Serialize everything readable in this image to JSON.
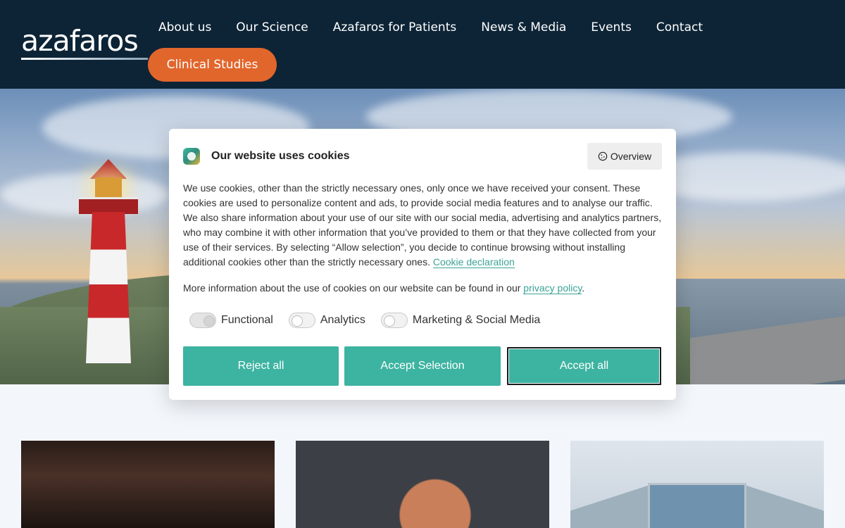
{
  "header": {
    "logo_text": "azafaros",
    "nav": [
      "About us",
      "Our Science",
      "Azafaros for Patients",
      "News & Media",
      "Events",
      "Contact"
    ],
    "cta_label": "Clinical Studies",
    "cta_color": "#e1662c",
    "background": "#0d2436"
  },
  "cookie_dialog": {
    "title": "Our website uses cookies",
    "overview_label": "Overview",
    "overview_icon": "cookie-icon",
    "body_text": "We use cookies, other than the strictly necessary ones, only once we have received your consent. These cookies are used to personalize content and ads, to provide social media features and to analyse our traffic. We also share information about your use of our site with our social media, advertising and analytics partners, who may combine it with other information that you’ve provided to them or that they have collected from your use of their services. By selecting “Allow selection”, you decide to continue browsing without installing additional cookies other than the strictly necessary ones.",
    "cookie_declaration_link": "Cookie declaration",
    "more_info_text": "More information about the use of cookies on our website can be found in our",
    "privacy_link": "privacy policy",
    "more_info_end": ".",
    "toggles": [
      {
        "label": "Functional",
        "state": "on"
      },
      {
        "label": "Analytics",
        "state": "off"
      },
      {
        "label": "Marketing & Social Media",
        "state": "off"
      }
    ],
    "buttons": {
      "reject": "Reject all",
      "accept_selection": "Accept Selection",
      "accept_all": "Accept all"
    },
    "accent_color": "#3db3a1"
  }
}
